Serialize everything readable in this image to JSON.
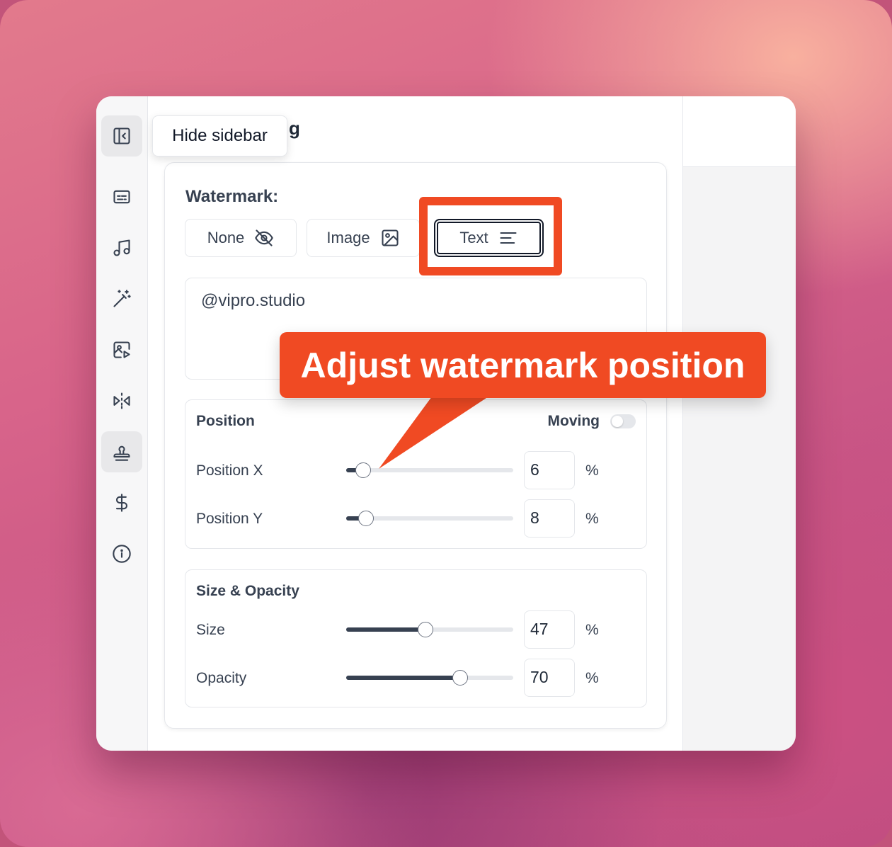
{
  "page": {
    "title_visible_fragment": "g"
  },
  "tooltip": {
    "text": "Hide sidebar"
  },
  "sidebar": {
    "items": [
      {
        "name": "toggle-sidebar",
        "icon": "sidebar-collapse-icon"
      },
      {
        "name": "captions",
        "icon": "subtitles-icon"
      },
      {
        "name": "music",
        "icon": "music-note-icon"
      },
      {
        "name": "effects",
        "icon": "magic-wand-icon"
      },
      {
        "name": "media",
        "icon": "image-play-icon"
      },
      {
        "name": "flip",
        "icon": "flip-horizontal-icon"
      },
      {
        "name": "watermark",
        "icon": "stamp-icon",
        "active": true
      },
      {
        "name": "pricing",
        "icon": "dollar-icon"
      },
      {
        "name": "info",
        "icon": "info-icon"
      }
    ]
  },
  "watermark": {
    "label": "Watermark:",
    "options": {
      "none": "None",
      "image": "Image",
      "text": "Text"
    },
    "selected": "Text",
    "text_value": "@vipro.studio"
  },
  "position": {
    "title": "Position",
    "moving_label": "Moving",
    "moving_enabled": false,
    "x_label": "Position X",
    "x_value": "6",
    "y_label": "Position Y",
    "y_value": "8",
    "unit": "%"
  },
  "size_opacity": {
    "title": "Size & Opacity",
    "size_label": "Size",
    "size_value": "47",
    "opacity_label": "Opacity",
    "opacity_value": "70",
    "unit": "%"
  },
  "annotation": {
    "callout_text": "Adjust watermark position",
    "color": "#f04a23"
  }
}
